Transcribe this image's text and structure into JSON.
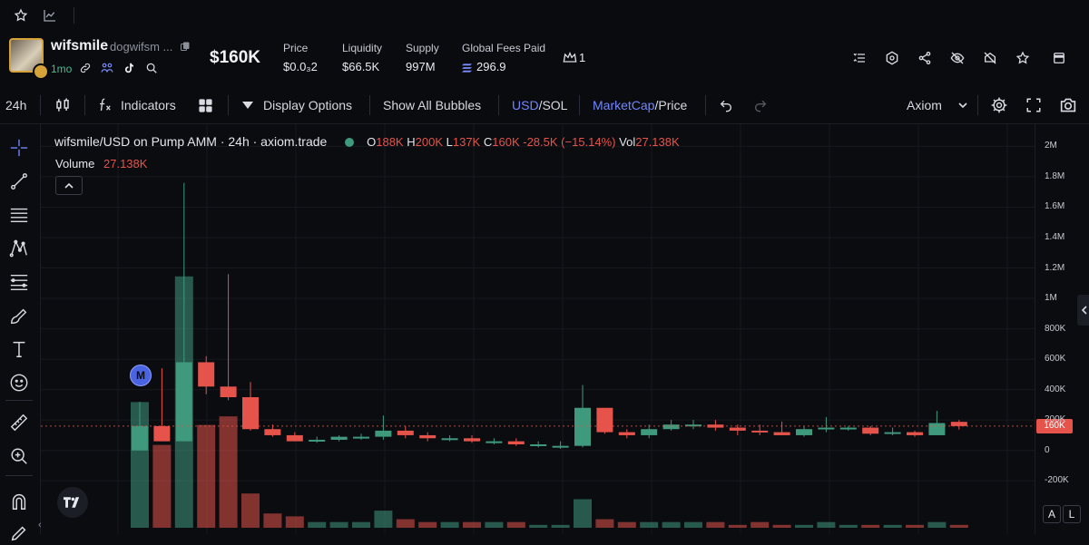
{
  "token": {
    "name": "wifsmile",
    "ticker": "dogwifsm ...",
    "age": "1mo",
    "market_cap": "$160K"
  },
  "stats": [
    {
      "label": "Price",
      "value": "$0.0₃2"
    },
    {
      "label": "Liquidity",
      "value": "$66.5K"
    },
    {
      "label": "Supply",
      "value": "997M"
    },
    {
      "label": "Global Fees Paid",
      "value": "296.9"
    }
  ],
  "holders_count": "1",
  "toolbar": {
    "interval": "24h",
    "indicators": "Indicators",
    "display_options": "Display Options",
    "show_bubbles": "Show All Bubbles",
    "usd": "USD",
    "slash": "/",
    "sol": "SOL",
    "mcap": "MarketCap",
    "price": "Price",
    "source": "Axiom"
  },
  "legend": {
    "title": "wifsmile/USD on Pump AMM · 24h · axiom.trade",
    "o_label": "O",
    "o_val": "188K",
    "h_label": "H",
    "h_val": "200K",
    "l_label": "L",
    "l_val": "137K",
    "c_label": "C",
    "c_val": "160K",
    "change": "-28.5K (−15.14%)",
    "vol_label": "Vol",
    "vol_val": "27.138K",
    "volume_label": "Volume",
    "volume_val": "27.138K"
  },
  "marker_label": "M",
  "scale_buttons": {
    "a": "A",
    "l": "L"
  },
  "colors": {
    "up": "#3f9a7d",
    "down": "#e5534b",
    "accent": "#5b7cfa",
    "bg": "#0b0c10"
  },
  "chart_data": {
    "type": "candlestick",
    "ylim": [
      -300000,
      2050000
    ],
    "y_ticks": [
      "2M",
      "1.8M",
      "1.6M",
      "1.4M",
      "1.2M",
      "1M",
      "800K",
      "600K",
      "400K",
      "200K",
      "0",
      "-200K"
    ],
    "y_tick_values": [
      2000000,
      1800000,
      1600000,
      1400000,
      1200000,
      1000000,
      800000,
      600000,
      400000,
      200000,
      0,
      -200000
    ],
    "last_price_label": "160K",
    "last_price": 160000,
    "candles": [
      {
        "o": 0,
        "h": 320000,
        "l": 0,
        "c": 160000,
        "v": 0.44
      },
      {
        "o": 160000,
        "h": 540000,
        "l": 60000,
        "c": 60000,
        "v": 0.29
      },
      {
        "o": 60000,
        "h": 1760000,
        "l": 60000,
        "c": 580000,
        "v": 0.88
      },
      {
        "o": 580000,
        "h": 620000,
        "l": 370000,
        "c": 420000,
        "v": 0.36
      },
      {
        "o": 420000,
        "h": 1160000,
        "l": 330000,
        "c": 350000,
        "v": 0.39
      },
      {
        "o": 350000,
        "h": 450000,
        "l": 130000,
        "c": 140000,
        "v": 0.12
      },
      {
        "o": 140000,
        "h": 170000,
        "l": 90000,
        "c": 100000,
        "v": 0.05
      },
      {
        "o": 100000,
        "h": 120000,
        "l": 60000,
        "c": 60000,
        "v": 0.04
      },
      {
        "o": 60000,
        "h": 90000,
        "l": 50000,
        "c": 70000,
        "v": 0.02
      },
      {
        "o": 70000,
        "h": 100000,
        "l": 60000,
        "c": 90000,
        "v": 0.02
      },
      {
        "o": 90000,
        "h": 110000,
        "l": 70000,
        "c": 90000,
        "v": 0.02
      },
      {
        "o": 90000,
        "h": 230000,
        "l": 70000,
        "c": 130000,
        "v": 0.06
      },
      {
        "o": 130000,
        "h": 160000,
        "l": 80000,
        "c": 100000,
        "v": 0.03
      },
      {
        "o": 100000,
        "h": 120000,
        "l": 60000,
        "c": 80000,
        "v": 0.02
      },
      {
        "o": 80000,
        "h": 100000,
        "l": 60000,
        "c": 80000,
        "v": 0.02
      },
      {
        "o": 80000,
        "h": 100000,
        "l": 50000,
        "c": 60000,
        "v": 0.02
      },
      {
        "o": 60000,
        "h": 80000,
        "l": 40000,
        "c": 60000,
        "v": 0.02
      },
      {
        "o": 60000,
        "h": 80000,
        "l": 30000,
        "c": 40000,
        "v": 0.02
      },
      {
        "o": 40000,
        "h": 60000,
        "l": 20000,
        "c": 40000,
        "v": 0.01
      },
      {
        "o": 20000,
        "h": 60000,
        "l": 10000,
        "c": 30000,
        "v": 0.01
      },
      {
        "o": 30000,
        "h": 430000,
        "l": 20000,
        "c": 280000,
        "v": 0.1
      },
      {
        "o": 280000,
        "h": 280000,
        "l": 110000,
        "c": 120000,
        "v": 0.03
      },
      {
        "o": 120000,
        "h": 140000,
        "l": 80000,
        "c": 100000,
        "v": 0.02
      },
      {
        "o": 100000,
        "h": 170000,
        "l": 80000,
        "c": 140000,
        "v": 0.02
      },
      {
        "o": 140000,
        "h": 200000,
        "l": 130000,
        "c": 170000,
        "v": 0.02
      },
      {
        "o": 170000,
        "h": 200000,
        "l": 140000,
        "c": 170000,
        "v": 0.02
      },
      {
        "o": 170000,
        "h": 200000,
        "l": 130000,
        "c": 150000,
        "v": 0.02
      },
      {
        "o": 150000,
        "h": 170000,
        "l": 100000,
        "c": 130000,
        "v": 0.01
      },
      {
        "o": 130000,
        "h": 170000,
        "l": 100000,
        "c": 120000,
        "v": 0.02
      },
      {
        "o": 120000,
        "h": 190000,
        "l": 100000,
        "c": 100000,
        "v": 0.01
      },
      {
        "o": 100000,
        "h": 160000,
        "l": 90000,
        "c": 140000,
        "v": 0.01
      },
      {
        "o": 140000,
        "h": 220000,
        "l": 120000,
        "c": 150000,
        "v": 0.02
      },
      {
        "o": 150000,
        "h": 160000,
        "l": 130000,
        "c": 150000,
        "v": 0.01
      },
      {
        "o": 150000,
        "h": 160000,
        "l": 100000,
        "c": 110000,
        "v": 0.01
      },
      {
        "o": 110000,
        "h": 150000,
        "l": 100000,
        "c": 120000,
        "v": 0.01
      },
      {
        "o": 120000,
        "h": 130000,
        "l": 90000,
        "c": 100000,
        "v": 0.01
      },
      {
        "o": 100000,
        "h": 260000,
        "l": 100000,
        "c": 180000,
        "v": 0.02
      },
      {
        "o": 188000,
        "h": 200000,
        "l": 137000,
        "c": 160000,
        "v": 0.01
      }
    ]
  }
}
